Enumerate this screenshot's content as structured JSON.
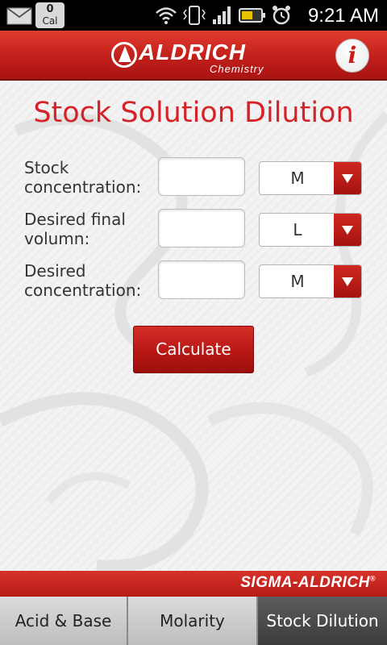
{
  "status_bar": {
    "calorie_count": "0",
    "calorie_label": "Cal",
    "time": "9:21 AM"
  },
  "header": {
    "logo_text": "ALDRICH",
    "logo_subtext": "Chemistry",
    "info_label": "i"
  },
  "page": {
    "title": "Stock Solution Dilution"
  },
  "form": {
    "rows": [
      {
        "label_line1": "Stock",
        "label_line2": "concentration:",
        "value": "",
        "unit": "M"
      },
      {
        "label_line1": "Desired final",
        "label_line2": "volumn:",
        "value": "",
        "unit": "L"
      },
      {
        "label_line1": "Desired",
        "label_line2": "concentration:",
        "value": "",
        "unit": "M"
      }
    ],
    "calculate_label": "Calculate"
  },
  "footer": {
    "brand": "SIGMA-ALDRICH",
    "brand_mark": "®"
  },
  "tabs": [
    {
      "label": "Acid & Base",
      "active": false
    },
    {
      "label": "Molarity",
      "active": false
    },
    {
      "label": "Stock Dilution",
      "active": true
    }
  ],
  "colors": {
    "brand_red": "#c11f1a",
    "title_red": "#d4242a",
    "active_tab": "#3b3b3b"
  }
}
